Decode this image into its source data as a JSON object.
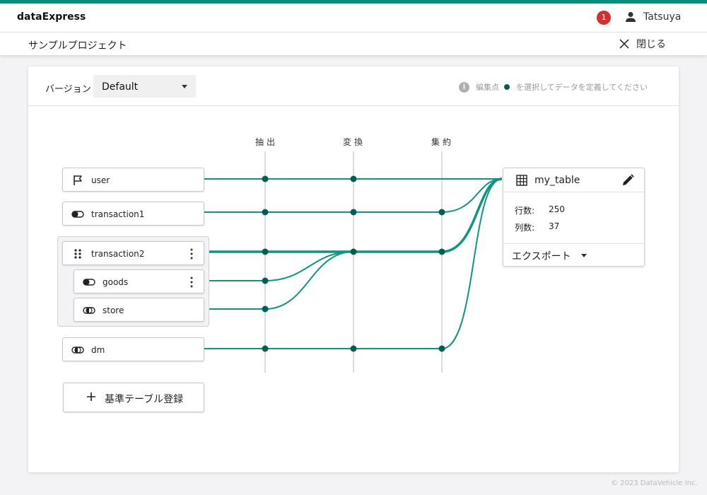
{
  "app": {
    "brand": "dataExpress",
    "notification_count": "1",
    "user_name": "Tatsuya"
  },
  "header": {
    "project_title": "サンプルプロジェクト",
    "close_label": "閉じる"
  },
  "toolbar": {
    "version_label": "バージョン",
    "version_value": "Default",
    "hint_prefix": "編集点",
    "hint_suffix": "を選択してデータを定義してください"
  },
  "columns": [
    {
      "label": "抽出"
    },
    {
      "label": "変換"
    },
    {
      "label": "集約"
    }
  ],
  "sources": [
    {
      "label": "user",
      "icon": "flag-icon"
    },
    {
      "label": "transaction1",
      "icon": "toggle-icon"
    },
    {
      "label": "transaction2",
      "icon": "drag-handle-icon"
    },
    {
      "label": "goods",
      "icon": "toggle-icon"
    },
    {
      "label": "store",
      "icon": "half-circle-icon"
    },
    {
      "label": "dm",
      "icon": "half-circle-icon"
    }
  ],
  "add_button_label": "基準テーブル登録",
  "output": {
    "name": "my_table",
    "rows_label": "行数:",
    "rows_value": "250",
    "cols_label": "列数:",
    "cols_value": "37",
    "export_label": "エクスポート"
  },
  "colors": {
    "accent": "#00927e",
    "line": "#0d9484",
    "point": "#005e52",
    "badge": "#d32f2f"
  },
  "footer": "© 2023 DataVehicle Inc."
}
